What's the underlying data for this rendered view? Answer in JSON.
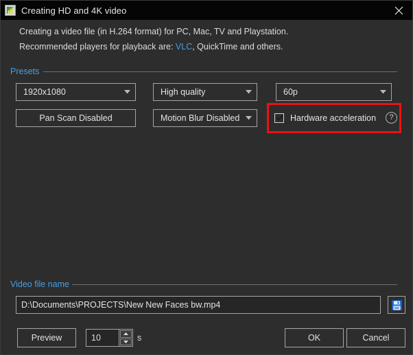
{
  "window": {
    "title": "Creating HD and 4K video",
    "title_icon": "video-file-icon",
    "close_icon": "close-icon",
    "bg_color": "#2d2d2d",
    "titlebar_color": "#050505",
    "accent_color": "#4a9ee0",
    "highlight_color": "#ee1111"
  },
  "description": {
    "line1": "Creating a video file (in H.264 format) for PC, Mac, TV and Playstation.",
    "line2_prefix": "Recommended players for playback are:",
    "line2_link": "VLC",
    "line2_suffix": ", QuickTime and others."
  },
  "presets": {
    "group_label": "Presets",
    "resolution": {
      "value": "1920x1080",
      "arrow_icon": "chevron-down-icon"
    },
    "quality": {
      "value": "High quality",
      "arrow_icon": "chevron-down-icon"
    },
    "framerate": {
      "value": "60p",
      "arrow_icon": "chevron-down-icon"
    },
    "pan_scan": {
      "label": "Pan  Scan Disabled"
    },
    "motion_blur": {
      "value": "Motion Blur Disabled",
      "arrow_icon": "chevron-down-icon"
    },
    "hardware_acceleration": {
      "label": "Hardware acceleration",
      "checked": true,
      "check_icon": "checkmark-icon",
      "help_icon": "?",
      "highlighted": true
    }
  },
  "video_file": {
    "group_label": "Video file name",
    "path": "D:\\Documents\\PROJECTS\\New New Faces bw.mp4",
    "placeholder": "",
    "save_icon": "floppy-disk-save-icon"
  },
  "footer": {
    "preview_label": "Preview",
    "duration_value": "10",
    "duration_unit": "s",
    "spin_up_icon": "caret-up-icon",
    "spin_down_icon": "caret-down-icon",
    "ok_label": "OK",
    "cancel_label": "Cancel"
  }
}
